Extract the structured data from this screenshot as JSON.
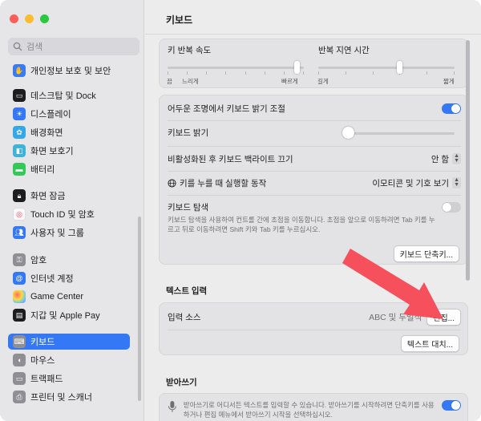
{
  "search": {
    "placeholder": "검색"
  },
  "sidebar": {
    "items": [
      {
        "label": "개인정보 보호 및 보안",
        "icon": "hand-icon",
        "color": "#3a7bf5"
      },
      {
        "label": "데스크탑 및 Dock",
        "icon": "dock-icon",
        "color": "#1d1d1f"
      },
      {
        "label": "디스플레이",
        "icon": "sun-icon",
        "color": "#3478f6"
      },
      {
        "label": "배경화면",
        "icon": "flower-icon",
        "color": "#36a8e8"
      },
      {
        "label": "화면 보호기",
        "icon": "screensaver-icon",
        "color": "#3fb2d8"
      },
      {
        "label": "배터리",
        "icon": "battery-icon",
        "color": "#34c759"
      },
      {
        "label": "화면 잠금",
        "icon": "lock-icon",
        "color": "#1d1d1f"
      },
      {
        "label": "Touch ID 및 암호",
        "icon": "fingerprint-icon",
        "color": "#f9f9f9"
      },
      {
        "label": "사용자 및 그룹",
        "icon": "users-icon",
        "color": "#3478f6"
      },
      {
        "label": "암호",
        "icon": "key-icon",
        "color": "#8e8e93"
      },
      {
        "label": "인터넷 계정",
        "icon": "at-icon",
        "color": "#3478f6"
      },
      {
        "label": "Game Center",
        "icon": "gamecenter-icon",
        "color": "#ffffff"
      },
      {
        "label": "지갑 및 Apple Pay",
        "icon": "wallet-icon",
        "color": "#1d1d1f"
      },
      {
        "label": "키보드",
        "icon": "keyboard-icon",
        "color": "#8e8e93"
      },
      {
        "label": "마우스",
        "icon": "mouse-icon",
        "color": "#8e8e93"
      },
      {
        "label": "트랙패드",
        "icon": "trackpad-icon",
        "color": "#8e8e93"
      },
      {
        "label": "프린터 및 스캐너",
        "icon": "printer-icon",
        "color": "#8e8e93"
      }
    ],
    "selected_index": 13
  },
  "main": {
    "title": "키보드",
    "key_repeat": {
      "label": "키 반복 속도",
      "left_label": "끔",
      "mid_label": "느리게",
      "right_label": "빠르게",
      "value_fraction": 0.97
    },
    "repeat_delay": {
      "label": "반복 지연 시간",
      "left_label": "길게",
      "right_label": "짧게",
      "value_fraction": 0.6
    },
    "dim_backlight": {
      "label": "어두운 조명에서 키보드 밝기 조절",
      "on": true
    },
    "brightness": {
      "label": "키보드 밝기",
      "value_fraction": 0.0
    },
    "backlight_off": {
      "label": "비활성화된 후 키보드 백라이트 끄기",
      "value": "안 함"
    },
    "globe_key": {
      "label": "키를 누를 때 실행할 동작",
      "value": "이모티콘 및 기호 보기"
    },
    "keyboard_nav": {
      "label": "키보드 탐색",
      "description": "키보드 탐색을 사용하여 컨트롤 간에 초점을 이동합니다. 초점을 앞으로 이동하려면 Tab 키를 누르고 뒤로 이동하려면 Shift 키와 Tab 키를 누르십시오.",
      "on": false
    },
    "shortcuts_button": "키보드 단축키...",
    "text_input": {
      "section_title": "텍스트 입력",
      "input_sources_label": "입력 소스",
      "input_sources_value": "ABC 및 두벌식",
      "edit_button": "편집...",
      "text_replace_button": "텍스트 대치..."
    },
    "dictation": {
      "section_title": "받아쓰기",
      "description": "받아쓰기로 어디서든 텍스트를 입력할 수 있습니다. 받아쓰기를 시작하려면 단축키를 사용하거나 편집 메뉴에서 받아쓰기 시작을 선택하십시오.",
      "on": true
    }
  },
  "colors": {
    "accent": "#3478f6",
    "arrow": "#f7505d"
  }
}
